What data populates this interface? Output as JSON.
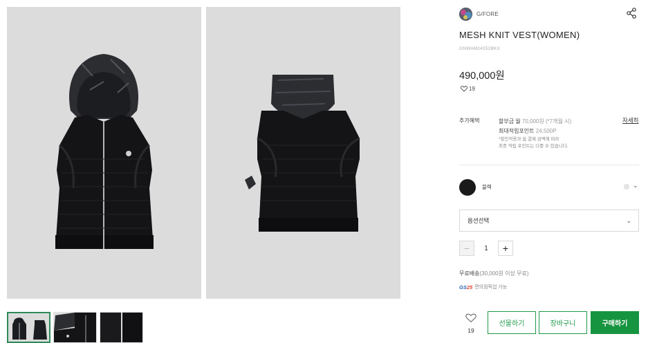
{
  "brand": {
    "name": "G/FORE"
  },
  "product": {
    "title": "MESH KNIT VEST(WOMEN)",
    "code": "GNWAM24352BKX",
    "price": "490,000원",
    "likes": "19"
  },
  "benefits": {
    "label": "추가혜택",
    "installment_prefix": "할부금 월",
    "installment_amount": "70,000원 (*7개월 시)",
    "points_prefix": "최대적립포인트",
    "points_amount": "24,500P",
    "note_line1": "*할인적용과 쉼 결제 금액에 따라",
    "note_line2": "최종 적립 포인트는 다를 수 있습니다.",
    "detail_link": "자세히"
  },
  "color": {
    "selected_name": "블랙"
  },
  "option": {
    "placeholder": "옵션선택"
  },
  "quantity": {
    "value": "1",
    "minus": "−",
    "plus": "+"
  },
  "shipping": {
    "label": "무료배송",
    "condition": "(30,000원 이상 무료)"
  },
  "gs25": {
    "badge_gs": "GS",
    "badge_num": "25",
    "text": "편의점픽업 가능"
  },
  "actions": {
    "like_count": "19",
    "gift": "선물하기",
    "cart": "장바구니",
    "buy": "구매하기"
  },
  "colors": {
    "accent_green": "#17943f",
    "swatch_black": "#1a1a1a",
    "image_bg": "#dcdcdc"
  }
}
